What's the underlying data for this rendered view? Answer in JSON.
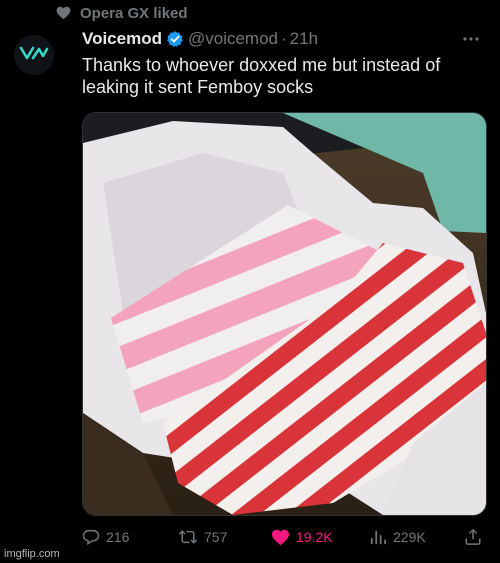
{
  "social_context": {
    "text": "Opera GX liked",
    "icon": "heart-icon"
  },
  "tweet": {
    "author_name": "Voicemod",
    "verified": true,
    "handle": "@voicemod",
    "separator": "·",
    "time": "21h",
    "text": "Thanks to whoever doxxed me but instead of\nleaking it sent Femboy socks",
    "avatar_icon": "voicemod-logo-icon",
    "more_icon": "more-icon"
  },
  "media": {
    "kind": "photo",
    "content": "cardboard box lined with white tissue paper holding pink-and-white and red-and-white striped socks"
  },
  "actions": {
    "replies": "216",
    "retweets": "757",
    "likes": "19.2K",
    "views": "229K"
  },
  "colors": {
    "background": "#000000",
    "text": "#e7e9ea",
    "muted": "#71767b",
    "like": "#f91880",
    "verified": "#1d9bf0",
    "logo": "#38d6c4"
  },
  "watermark": "imgflip.com"
}
